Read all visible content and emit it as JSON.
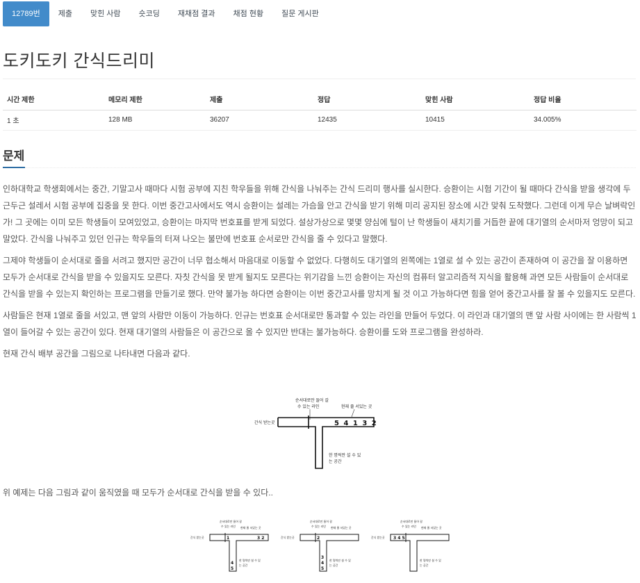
{
  "nav": {
    "items": [
      "12789번",
      "제출",
      "맞힌 사람",
      "숏코딩",
      "재채점 결과",
      "채점 현황",
      "질문 게시판"
    ]
  },
  "problem": {
    "title": "도키도키 간식드리미"
  },
  "stats": {
    "headers": [
      "시간 제한",
      "메모리 제한",
      "제출",
      "정답",
      "맞힌 사람",
      "정답 비율"
    ],
    "values": [
      "1 초",
      "128 MB",
      "36207",
      "12435",
      "10415",
      "34.005%"
    ]
  },
  "section": {
    "heading": "문제"
  },
  "description": {
    "p1": "인하대학교 학생회에서는 중간, 기말고사 때마다 시험 공부에 지친 학우들을 위해 간식을 나눠주는 간식 드리미 행사를 실시한다. 승환이는 시험 기간이 될 때마다 간식을 받을 생각에 두근두근 설레서 시험 공부에 집중을 못 한다. 이번 중간고사에서도 역시 승환이는 설레는 가슴을 안고 간식을 받기 위해 미리 공지된 장소에 시간 맞춰 도착했다. 그런데 이게 무슨 날벼락인가! 그 곳에는 이미 모든 학생들이 모여있었고, 승환이는 마지막 번호표를 받게 되었다. 설상가상으로 몇몇 양심에 털이 난 학생들이 새치기를 거듭한 끝에 대기열의 순서마저 엉망이 되고 말았다. 간식을 나눠주고 있던 인규는 학우들의 터져 나오는 불만에 번호표 순서로만 간식을 줄 수 있다고 말했다.",
    "p2": "그제야 학생들이 순서대로 줄을 서려고 했지만 공간이 너무 협소해서 마음대로 이동할 수 없었다. 다행히도 대기열의 왼쪽에는 1열로 설 수 있는 공간이 존재하여 이 공간을 잘 이용하면 모두가 순서대로 간식을 받을 수 있을지도 모른다. 자칫 간식을 못 받게 될지도 모른다는 위기감을 느낀 승환이는 자신의 컴퓨터 알고리즘적 지식을 활용해 과연 모든 사람들이 순서대로 간식을 받을 수 있는지 확인하는 프로그램을 만들기로 했다. 만약 불가능 하다면 승환이는 이번 중간고사를 망치게 될 것 이고 가능하다면 힘을 얻어 중간고사를 잘 볼 수 있을지도 모른다.",
    "p3": "사람들은 현재 1열로 줄을 서있고, 맨 앞의 사람만 이동이 가능하다. 인규는 번호표 순서대로만 통과할 수 있는 라인을 만들어 두었다. 이 라인과 대기열의 맨 앞 사람 사이에는 한 사람씩 1열이 들어갈 수 있는 공간이 있다. 현재 대기열의 사람들은 이 공간으로 올 수 있지만 반대는 불가능하다. 승환이를 도와 프로그램을 완성하라.",
    "p4": "현재 간식 배부 공간을 그림으로 나타내면 다음과 같다.",
    "p5": "위 예제는 다음 그림과 같이 움직였을 때 모두가 순서대로 간식을 받을 수 있다.."
  },
  "figure1": {
    "label_line": "순서대로만 들어 갈",
    "label_line2": "수 있는 라인",
    "label_queue": "현재 줄 서있는 곳",
    "label_receive": "간식 받는곳",
    "label_side": "한 명씩만 설 수 있",
    "label_side2": "는 공간",
    "queue": "5 4 1 3 2"
  },
  "figure2": {
    "label_line": "순서대로만 들어 갈",
    "label_line2": "수 있는 라인",
    "label_queue": "현재 줄 서있는 곳",
    "label_receive": "간식 받는곳",
    "label_side": "한 명씩만 설 수 있",
    "label_side2": "는 공간",
    "steps": [
      {
        "receive": "",
        "line": "1",
        "queue": "3 2",
        "stack": [
          "4",
          "5"
        ]
      },
      {
        "receive": "",
        "line": "2",
        "queue": "",
        "stack": [
          "3",
          "4",
          "5"
        ]
      },
      {
        "receive": "3 4 5",
        "line": "",
        "queue": "",
        "stack": []
      }
    ]
  }
}
